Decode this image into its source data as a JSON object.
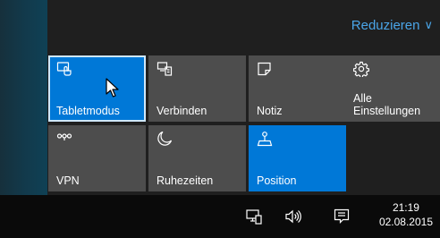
{
  "colors": {
    "accent": "#0078d7",
    "tile": "#4d4d4d",
    "link": "#4aa5e8",
    "taskbar": "#0a0a0a"
  },
  "action_center": {
    "collapse_label": "Reduzieren",
    "collapse_icon": "chevron-down-icon",
    "tiles": [
      {
        "label": "Tabletmodus",
        "icon": "tablet-mode-icon",
        "active": true
      },
      {
        "label": "Verbinden",
        "icon": "connect-icon",
        "active": false
      },
      {
        "label": "Notiz",
        "icon": "note-icon",
        "active": false
      },
      {
        "label": "Alle Einstellungen",
        "icon": "gear-icon",
        "active": false
      },
      {
        "label": "VPN",
        "icon": "vpn-icon",
        "active": false
      },
      {
        "label": "Ruhezeiten",
        "icon": "moon-icon",
        "active": false
      },
      {
        "label": "Position",
        "icon": "location-icon",
        "active": true
      }
    ]
  },
  "taskbar": {
    "tray_icons": [
      "network-icon",
      "volume-icon",
      "action-center-icon"
    ],
    "clock": {
      "time": "21:19",
      "date": "02.08.2015"
    }
  }
}
